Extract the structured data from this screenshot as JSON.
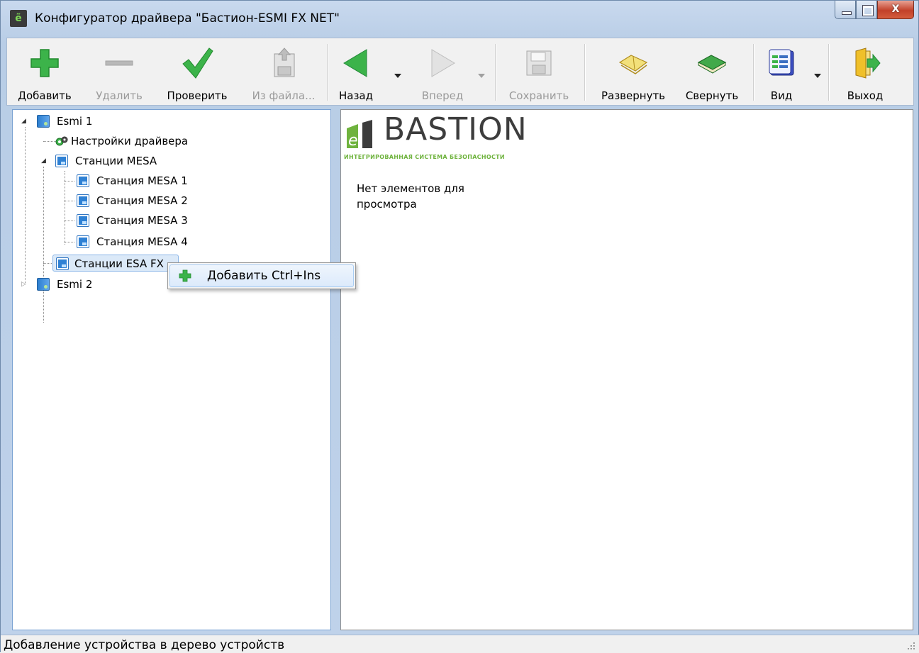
{
  "window": {
    "title": "Конфигуратор драйвера \"Бастион-ESMI FX NET\"",
    "close_glyph": "X"
  },
  "toolbar": {
    "add": "Добавить",
    "remove": "Удалить",
    "check": "Проверить",
    "from_file": "Из файла...",
    "back": "Назад",
    "forward": "Вперед",
    "save": "Сохранить",
    "expand": "Развернуть",
    "collapse": "Свернуть",
    "view": "Вид",
    "exit": "Выход"
  },
  "tree": {
    "nodes": [
      {
        "label": "Esmi 1"
      },
      {
        "label": "Настройки драйвера"
      },
      {
        "label": "Станции MESA"
      },
      {
        "label": "Станция MESA 1"
      },
      {
        "label": "Станция MESA 2"
      },
      {
        "label": "Станция MESA 3"
      },
      {
        "label": "Станция MESA 4"
      },
      {
        "label": "Станции ESA FX"
      },
      {
        "label": "Esmi 2"
      }
    ]
  },
  "context_menu": {
    "add_label": "Добавить Ctrl+Ins"
  },
  "content": {
    "logo_text": "BASTION",
    "logo_subtitle": "ИНТЕГРИРОВАННАЯ СИСТЕМА БЕЗОПАСНОСТИ",
    "empty_message": "Нет элементов для просмотра"
  },
  "status": {
    "text": "Добавление устройства в дерево устройств"
  },
  "colors": {
    "accent_green": "#3cb34a",
    "logo_green": "#6fb33e",
    "selection_blue": "#8bb6e8"
  }
}
